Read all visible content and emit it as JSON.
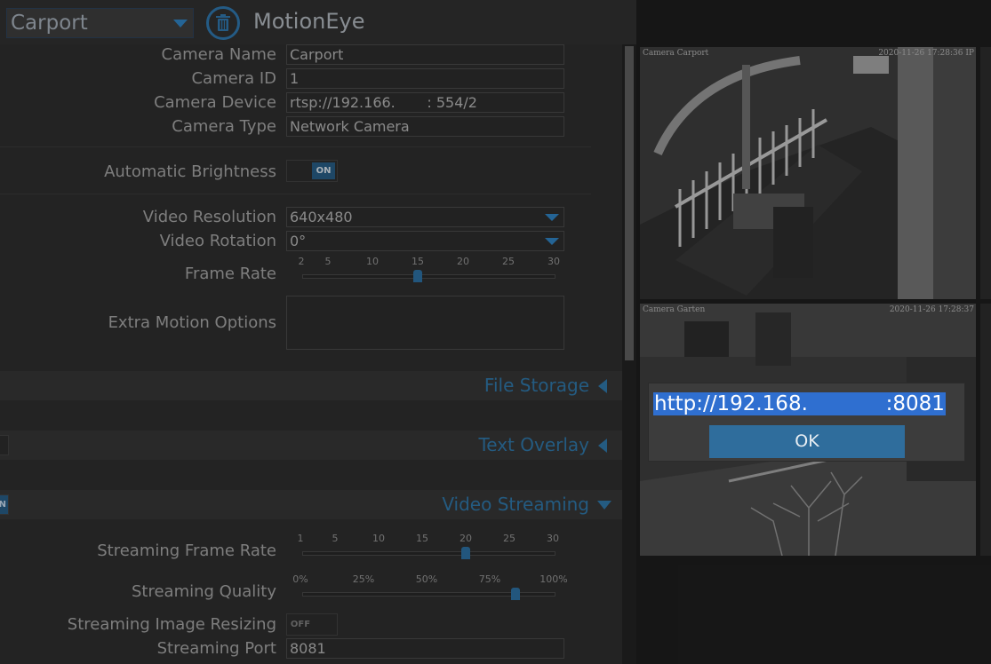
{
  "header": {
    "camera_select_value": "Carport",
    "app_title": "MotionEye"
  },
  "settings": {
    "camera_name_label": "Camera Name",
    "camera_name_value": "Carport",
    "camera_id_label": "Camera ID",
    "camera_id_value": "1",
    "camera_device_label": "Camera Device",
    "camera_device_value": "rtsp://192.166.       : 554/2",
    "camera_type_label": "Camera Type",
    "camera_type_value": "Network Camera",
    "auto_brightness_label": "Automatic Brightness",
    "auto_brightness_state": "ON",
    "video_resolution_label": "Video Resolution",
    "video_resolution_value": "640x480",
    "video_rotation_label": "Video Rotation",
    "video_rotation_value": "0°",
    "frame_rate_label": "Frame Rate",
    "frame_rate_ticks": [
      "2",
      "5",
      "10",
      "15",
      "20",
      "25",
      "30"
    ],
    "frame_rate_value": 15,
    "extra_motion_label": "Extra Motion Options",
    "extra_motion_value": ""
  },
  "sections": {
    "file_storage": "File Storage",
    "text_overlay": "Text Overlay",
    "video_streaming": "Video Streaming",
    "video_streaming_toggle": "N"
  },
  "streaming": {
    "frame_rate_label": "Streaming Frame Rate",
    "frame_rate_ticks": [
      "1",
      "5",
      "10",
      "15",
      "20",
      "25",
      "30"
    ],
    "frame_rate_value": 20,
    "quality_label": "Streaming Quality",
    "quality_ticks": [
      "0%",
      "25%",
      "50%",
      "75%",
      "100%"
    ],
    "quality_value": 85,
    "resizing_label": "Streaming Image Resizing",
    "resizing_state": "OFF",
    "port_label": "Streaming Port",
    "port_value": "8081"
  },
  "cameras": [
    {
      "overlay_name": "Camera Carport",
      "overlay_time": "2020-11-26 17:28:36",
      "overlay_extra": "IP"
    },
    {
      "overlay_name": "Camera Garten",
      "overlay_time": "2020-11-26 17:28:37",
      "overlay_extra": ""
    }
  ],
  "dialog": {
    "url_text": "http://192.168.            :8081",
    "ok_label": "OK"
  }
}
